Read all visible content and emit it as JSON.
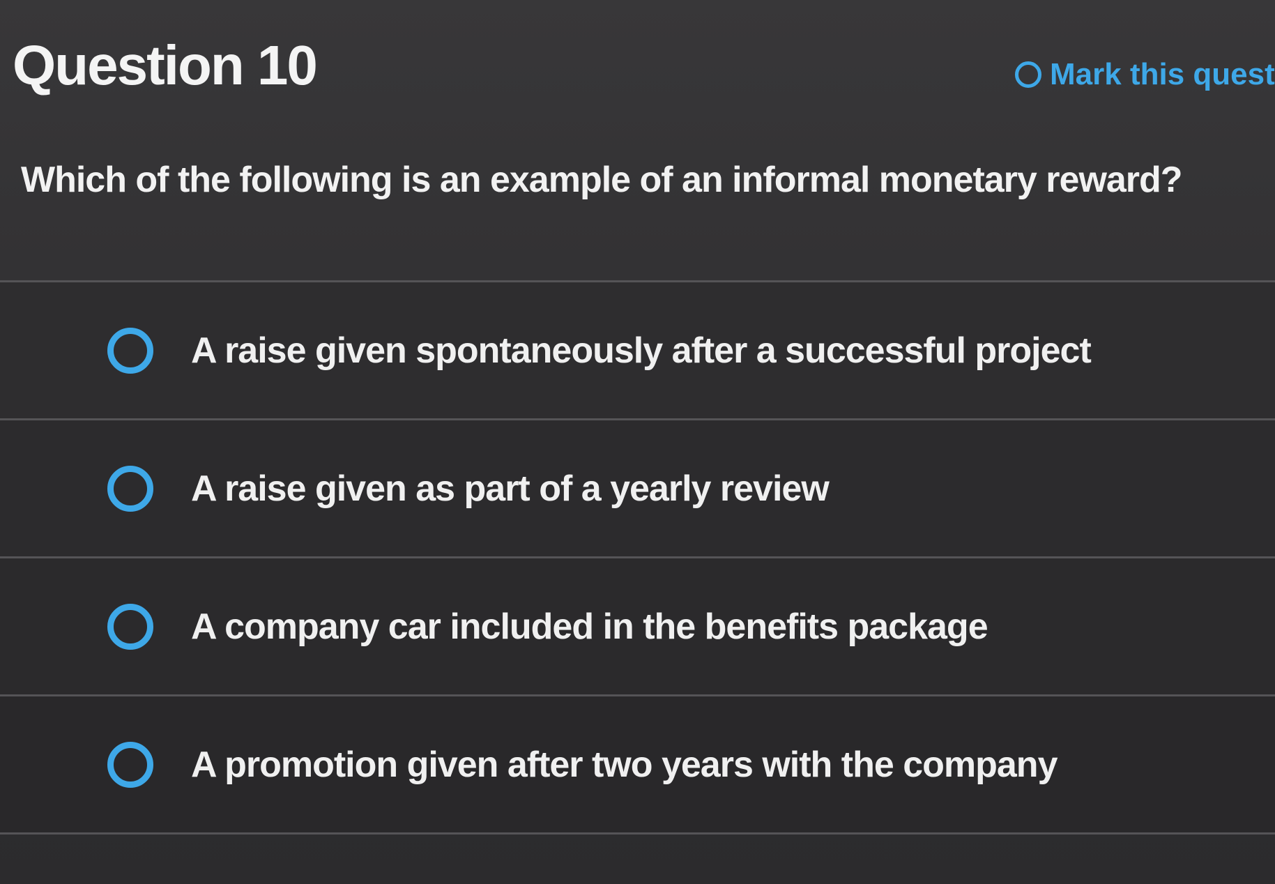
{
  "header": {
    "title": "Question 10",
    "mark_label": "Mark this quest"
  },
  "question": {
    "text": "Which of the following is an example of an informal monetary reward?"
  },
  "options": [
    {
      "label": "A raise given spontaneously after a successful project"
    },
    {
      "label": "A raise given as part of a yearly review"
    },
    {
      "label": "A company car included in the benefits package"
    },
    {
      "label": "A promotion given after two years with the company"
    }
  ],
  "colors": {
    "accent": "#3ea8e8",
    "background": "#2f2e30",
    "text": "#f1f1f1"
  },
  "icons": {
    "mark": "radio-circle-icon",
    "option": "radio-circle-icon"
  }
}
